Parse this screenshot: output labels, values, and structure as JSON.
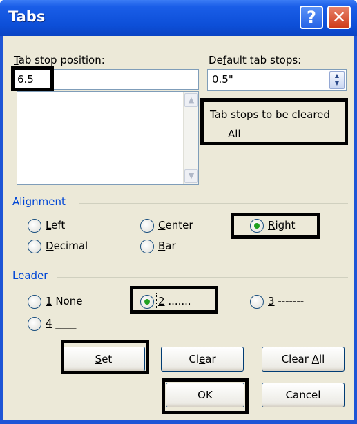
{
  "dialog": {
    "title": "Tabs",
    "help_symbol": "?",
    "close_symbol": "✕"
  },
  "tab_stop_position": {
    "label_pre": "",
    "label_ul": "T",
    "label_post": "ab stop position:",
    "value": "6.5",
    "list_items": []
  },
  "default_tab_stops": {
    "label_pre": "De",
    "label_ul": "f",
    "label_post": "ault tab stops:",
    "value": "0.5\""
  },
  "to_clear": {
    "label": "Tab stops to be cleared",
    "value": "All"
  },
  "alignment": {
    "group_label": "Alignment",
    "options": [
      {
        "pre": "",
        "ul": "L",
        "post": "eft",
        "checked": false
      },
      {
        "pre": "",
        "ul": "C",
        "post": "enter",
        "checked": false
      },
      {
        "pre": "",
        "ul": "R",
        "post": "ight",
        "checked": true
      },
      {
        "pre": "",
        "ul": "D",
        "post": "ecimal",
        "checked": false
      },
      {
        "pre": "",
        "ul": "B",
        "post": "ar",
        "checked": false
      }
    ]
  },
  "leader": {
    "group_label": "Leader",
    "options": [
      {
        "pre": "",
        "ul": "1",
        "post": " None",
        "checked": false
      },
      {
        "pre": "",
        "ul": "2",
        "post": " .......",
        "checked": true
      },
      {
        "pre": "",
        "ul": "3",
        "post": " -------",
        "checked": false
      },
      {
        "pre": "",
        "ul": "4",
        "post": " ____",
        "checked": false
      }
    ]
  },
  "buttons": {
    "set": {
      "pre": "",
      "ul": "S",
      "post": "et"
    },
    "clear": {
      "pre": "Cl",
      "ul": "e",
      "post": "ar"
    },
    "clear_all": {
      "pre": "Clear ",
      "ul": "A",
      "post": "ll"
    },
    "ok": {
      "label": "OK"
    },
    "cancel": {
      "label": "Cancel"
    }
  },
  "scroll_icons": {
    "up": "up-arrow-icon",
    "down": "down-arrow-icon"
  },
  "colors": {
    "title_bar": "#0d4fd8",
    "dialog_bg": "#ece9d8",
    "group_label": "#0046d5",
    "radio_dot": "#21a121",
    "close_button": "#cf3b18",
    "annotation_box": "#000000"
  }
}
